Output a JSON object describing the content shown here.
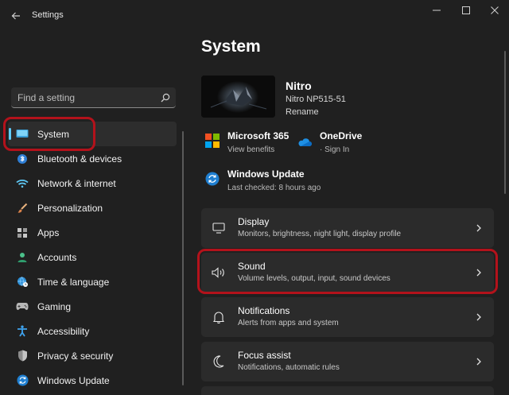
{
  "window": {
    "title": "Settings",
    "back_icon": "back-arrow-icon",
    "minimize_icon": "minimize-icon",
    "maximize_icon": "maximize-icon",
    "close_icon": "close-icon"
  },
  "search": {
    "placeholder": "Find a setting",
    "icon": "search-icon"
  },
  "sidebar": {
    "accent": "#60cdff",
    "items": [
      {
        "label": "System",
        "icon": "display-icon",
        "selected": true
      },
      {
        "label": "Bluetooth & devices",
        "icon": "bluetooth-icon"
      },
      {
        "label": "Network & internet",
        "icon": "wifi-icon"
      },
      {
        "label": "Personalization",
        "icon": "brush-icon"
      },
      {
        "label": "Apps",
        "icon": "apps-icon"
      },
      {
        "label": "Accounts",
        "icon": "person-icon"
      },
      {
        "label": "Time & language",
        "icon": "globe-clock-icon"
      },
      {
        "label": "Gaming",
        "icon": "gamepad-icon"
      },
      {
        "label": "Accessibility",
        "icon": "accessibility-icon"
      },
      {
        "label": "Privacy & security",
        "icon": "shield-icon"
      },
      {
        "label": "Windows Update",
        "icon": "sync-icon"
      }
    ]
  },
  "main": {
    "title": "System",
    "device": {
      "name": "Nitro",
      "model": "Nitro NP515-51",
      "rename_label": "Rename"
    },
    "quick_links": [
      {
        "title": "Microsoft 365",
        "subtitle": "View benefits",
        "icon": "microsoft-logo-icon"
      },
      {
        "title": "OneDrive",
        "subtitle": "· Sign In",
        "icon": "onedrive-cloud-icon"
      },
      {
        "title": "Windows Update",
        "subtitle": "Last checked: 8 hours ago",
        "icon": "windows-update-icon"
      }
    ],
    "cards": [
      {
        "title": "Display",
        "subtitle": "Monitors, brightness, night light, display profile",
        "icon": "monitor-icon"
      },
      {
        "title": "Sound",
        "subtitle": "Volume levels, output, input, sound devices",
        "icon": "speaker-icon"
      },
      {
        "title": "Notifications",
        "subtitle": "Alerts from apps and system",
        "icon": "bell-icon"
      },
      {
        "title": "Focus assist",
        "subtitle": "Notifications, automatic rules",
        "icon": "moon-icon"
      }
    ]
  },
  "annotation_color": "#b3121b"
}
